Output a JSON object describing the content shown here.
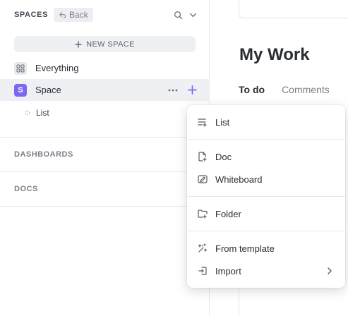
{
  "sidebar": {
    "title": "SPACES",
    "back_label": "Back",
    "new_space_label": "NEW SPACE",
    "items": [
      {
        "label": "Everything",
        "icon": "grid-icon"
      },
      {
        "label": "Space",
        "badge": "S",
        "icon": "space-avatar"
      },
      {
        "label": "List",
        "icon": "list-dot-icon"
      }
    ],
    "sections": [
      "DASHBOARDS",
      "DOCS"
    ]
  },
  "main": {
    "title": "My Work",
    "tabs": [
      {
        "label": "To do",
        "active": true
      },
      {
        "label": "Comments",
        "active": false
      }
    ]
  },
  "dropdown": {
    "items": [
      {
        "label": "List",
        "icon": "list-add-icon"
      },
      {
        "label": "Doc",
        "icon": "doc-add-icon"
      },
      {
        "label": "Whiteboard",
        "icon": "whiteboard-icon"
      },
      {
        "label": "Folder",
        "icon": "folder-add-icon"
      },
      {
        "label": "From template",
        "icon": "template-sparkle-icon"
      },
      {
        "label": "Import",
        "icon": "import-icon",
        "has_submenu": true
      }
    ]
  },
  "colors": {
    "accent": "#7b68ee",
    "text": "#292d34",
    "muted": "#7b7f87",
    "hover_bg": "#eef0f3"
  }
}
